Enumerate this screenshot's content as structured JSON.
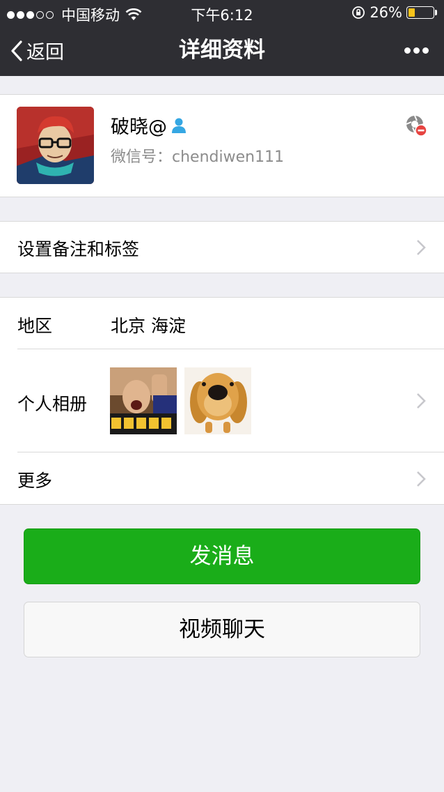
{
  "status_bar": {
    "signal_dots": [
      true,
      true,
      true,
      false,
      false
    ],
    "carrier": "中国移动",
    "time": "下午6:12",
    "battery_percent": "26%",
    "battery_level": 0.26,
    "battery_color": "#f7c31b"
  },
  "nav": {
    "back_label": "返回",
    "title": "详细资料",
    "more_icon": "more-dots-icon"
  },
  "profile": {
    "nickname": "破晓@",
    "wechat_id_label": "微信号：",
    "wechat_id": "chendiwen111",
    "action_icon": "blocked-moments-icon"
  },
  "rows": {
    "remark": {
      "label": "设置备注和标签"
    },
    "region": {
      "label": "地区",
      "value": "北京  海淀"
    },
    "album": {
      "label": "个人相册"
    },
    "more": {
      "label": "更多"
    }
  },
  "buttons": {
    "send_message": "发消息",
    "video_chat": "视频聊天"
  },
  "colors": {
    "nav_bg": "#2e2e33",
    "primary_green": "#1aad19",
    "page_bg": "#efeff4"
  }
}
